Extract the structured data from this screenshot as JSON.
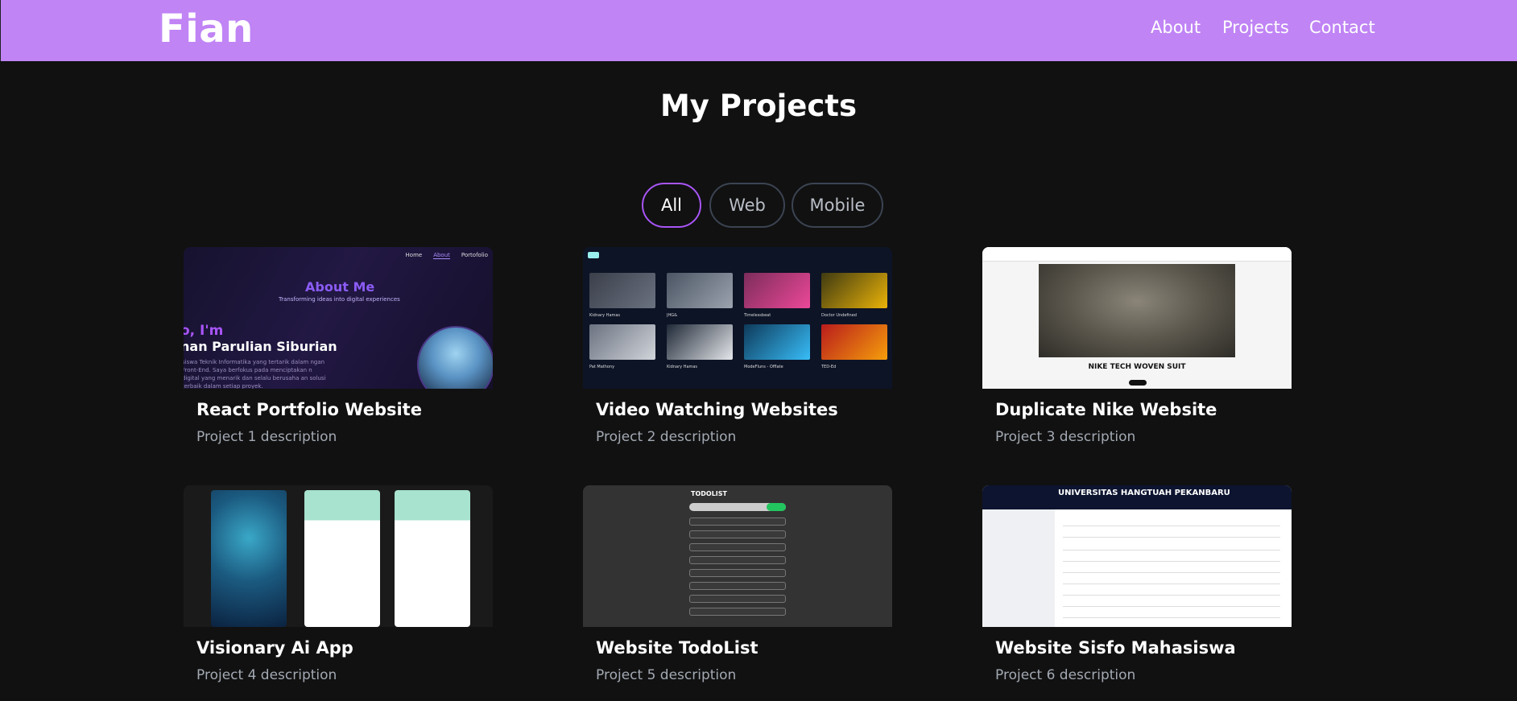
{
  "navbar": {
    "brand": "Fian",
    "links": [
      "About",
      "Projects",
      "Contact"
    ]
  },
  "page": {
    "title": "My Projects"
  },
  "filters": {
    "options": [
      "All",
      "Web",
      "Mobile"
    ],
    "active": "All"
  },
  "projects": [
    {
      "title": "React Portfolio Website",
      "description": "Project 1 description"
    },
    {
      "title": "Video Watching Websites",
      "description": "Project 2 description"
    },
    {
      "title": "Duplicate Nike Website",
      "description": "Project 3 description"
    },
    {
      "title": "Visionary Ai App",
      "description": "Project 4 description"
    },
    {
      "title": "Website TodoList",
      "description": "Project 5 description"
    },
    {
      "title": "Website Sisfo Mahasiswa",
      "description": "Project 6 description"
    }
  ],
  "thumbs": {
    "p1": {
      "nav": [
        "Home",
        "About",
        "Portofolio"
      ],
      "heading": "About Me",
      "tagline": "Transforming ideas into digital experiences",
      "greeting": "o, I'm",
      "name": "nan Parulian Siburian",
      "paragraph": "siswa Teknik Informatika yang tertarik dalam ngan Front-End. Saya berfokus pada menciptakan n digital yang menarik dan selalu berusaha an solusi terbaik dalam setiap proyek."
    },
    "p2": {
      "captions": [
        "Kidnary Hamas",
        "JHG&",
        "Timelessbeat",
        "Doctor Undefined",
        "Pat Mathony",
        "Kidnary Hamas",
        "ModeFluns - Offlate",
        "TED-Ed"
      ]
    },
    "p3": {
      "hero": "NIKE TECH WOVEN SUIT"
    },
    "p5": {
      "heading": "TODOLIST"
    },
    "p6": {
      "heading": "UNIVERSITAS HANGTUAH PEKANBARU"
    }
  }
}
